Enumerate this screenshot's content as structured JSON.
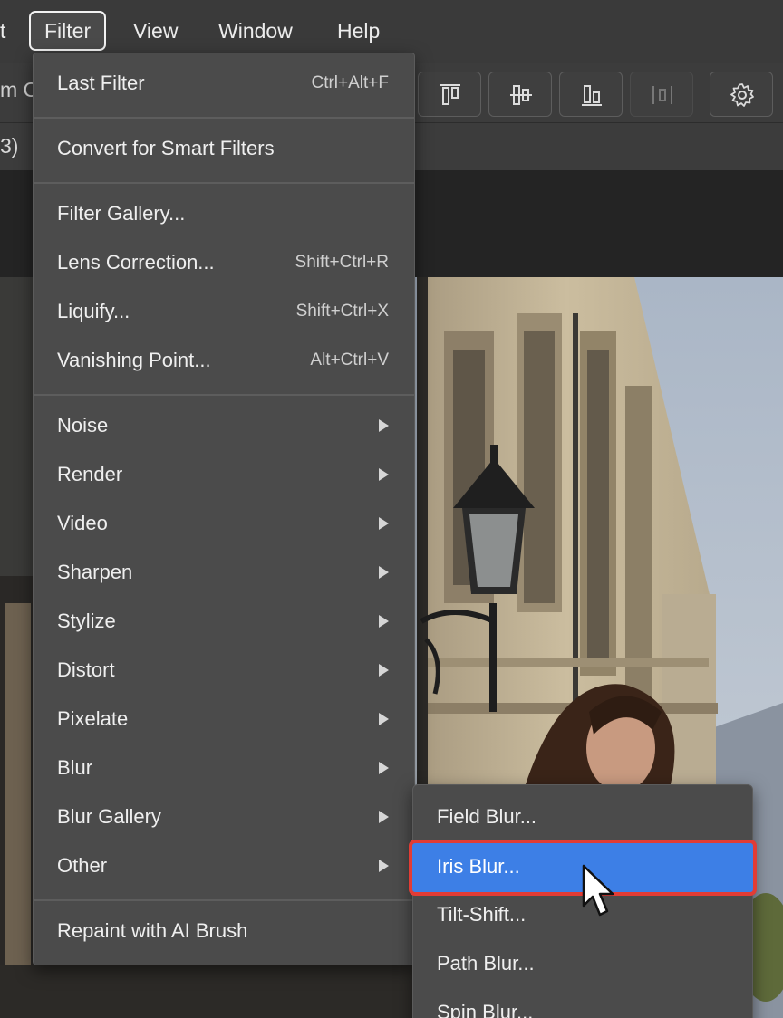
{
  "menubar": {
    "items": [
      {
        "label": "t"
      },
      {
        "label": "Filter"
      },
      {
        "label": "View"
      },
      {
        "label": "Window"
      },
      {
        "label": "Help"
      }
    ]
  },
  "optbar": {
    "partial_text": "m C",
    "buttons": [
      {
        "icon": "align-top-icon"
      },
      {
        "icon": "align-vertical-center-icon"
      },
      {
        "icon": "align-bottom-icon"
      },
      {
        "icon": "distribute-icon"
      },
      {
        "icon": "gear-icon"
      }
    ]
  },
  "tabbar": {
    "partial_text": "3)"
  },
  "filter_menu": {
    "last_filter": {
      "label": "Last Filter",
      "shortcut": "Ctrl+Alt+F"
    },
    "convert": {
      "label": "Convert for Smart Filters"
    },
    "gallery": {
      "label": "Filter Gallery..."
    },
    "lens": {
      "label": "Lens Correction...",
      "shortcut": "Shift+Ctrl+R"
    },
    "liquify": {
      "label": "Liquify...",
      "shortcut": "Shift+Ctrl+X"
    },
    "vanishing": {
      "label": "Vanishing Point...",
      "shortcut": "Alt+Ctrl+V"
    },
    "noise": {
      "label": "Noise"
    },
    "render": {
      "label": "Render"
    },
    "video": {
      "label": "Video"
    },
    "sharpen": {
      "label": "Sharpen"
    },
    "stylize": {
      "label": "Stylize"
    },
    "distort": {
      "label": "Distort"
    },
    "pixelate": {
      "label": "Pixelate"
    },
    "blur": {
      "label": "Blur"
    },
    "blur_gallery": {
      "label": "Blur Gallery"
    },
    "other": {
      "label": "Other"
    },
    "repaint": {
      "label": "Repaint with AI Brush"
    }
  },
  "blur_gallery_submenu": {
    "field": {
      "label": "Field Blur..."
    },
    "iris": {
      "label": "Iris Blur..."
    },
    "tilt": {
      "label": "Tilt-Shift..."
    },
    "path": {
      "label": "Path Blur..."
    },
    "spin": {
      "label": "Spin Blur..."
    }
  },
  "colors": {
    "menu_bg": "#4b4b4b",
    "highlight": "#3d7fe6",
    "annotation_outline": "#e23c35"
  }
}
